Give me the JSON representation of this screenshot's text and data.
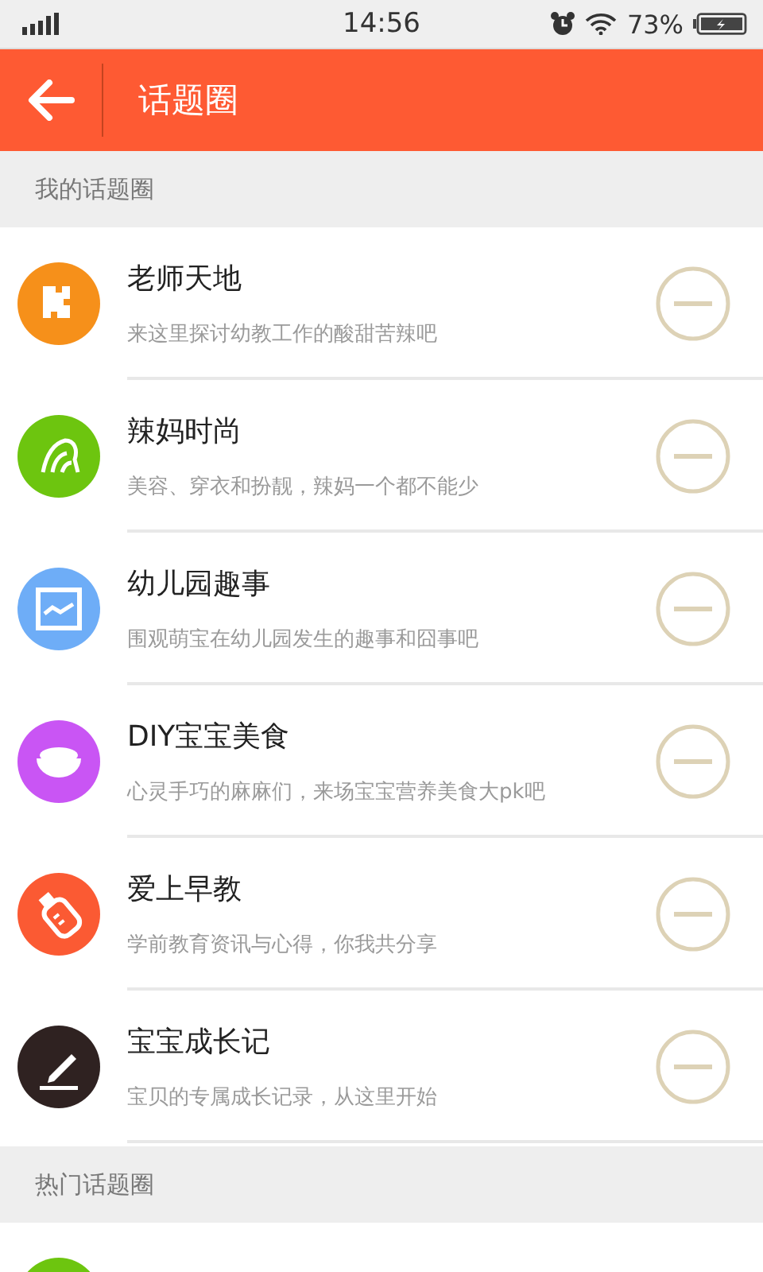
{
  "status_bar": {
    "time": "14:56",
    "battery": "73%"
  },
  "header": {
    "title": "话题圈"
  },
  "my_section": {
    "title": "我的话题圈"
  },
  "my_topics": [
    {
      "name": "老师天地",
      "description": "来这里探讨幼教工作的酸甜苦辣吧",
      "color": "#f6901a"
    },
    {
      "name": "辣妈时尚",
      "description": "美容、穿衣和扮靓，辣妈一个都不能少",
      "color": "#6dc50f"
    },
    {
      "name": "幼儿园趣事",
      "description": "围观萌宝在幼儿园发生的趣事和囧事吧",
      "color": "#6eadf7"
    },
    {
      "name": "DIY宝宝美食",
      "description": "心灵手巧的麻麻们，来场宝宝营养美食大pk吧",
      "color": "#c955f4"
    },
    {
      "name": "爱上早教",
      "description": "学前教育资讯与心得，你我共分享",
      "color": "#fb5a33"
    },
    {
      "name": "宝宝成长记",
      "description": "宝贝的专属成长记录，从这里开始",
      "color": "#2f2221"
    }
  ],
  "hot_section": {
    "title": "热门话题圈"
  },
  "hot_topics": [
    {
      "color": "#6dc50f"
    }
  ]
}
